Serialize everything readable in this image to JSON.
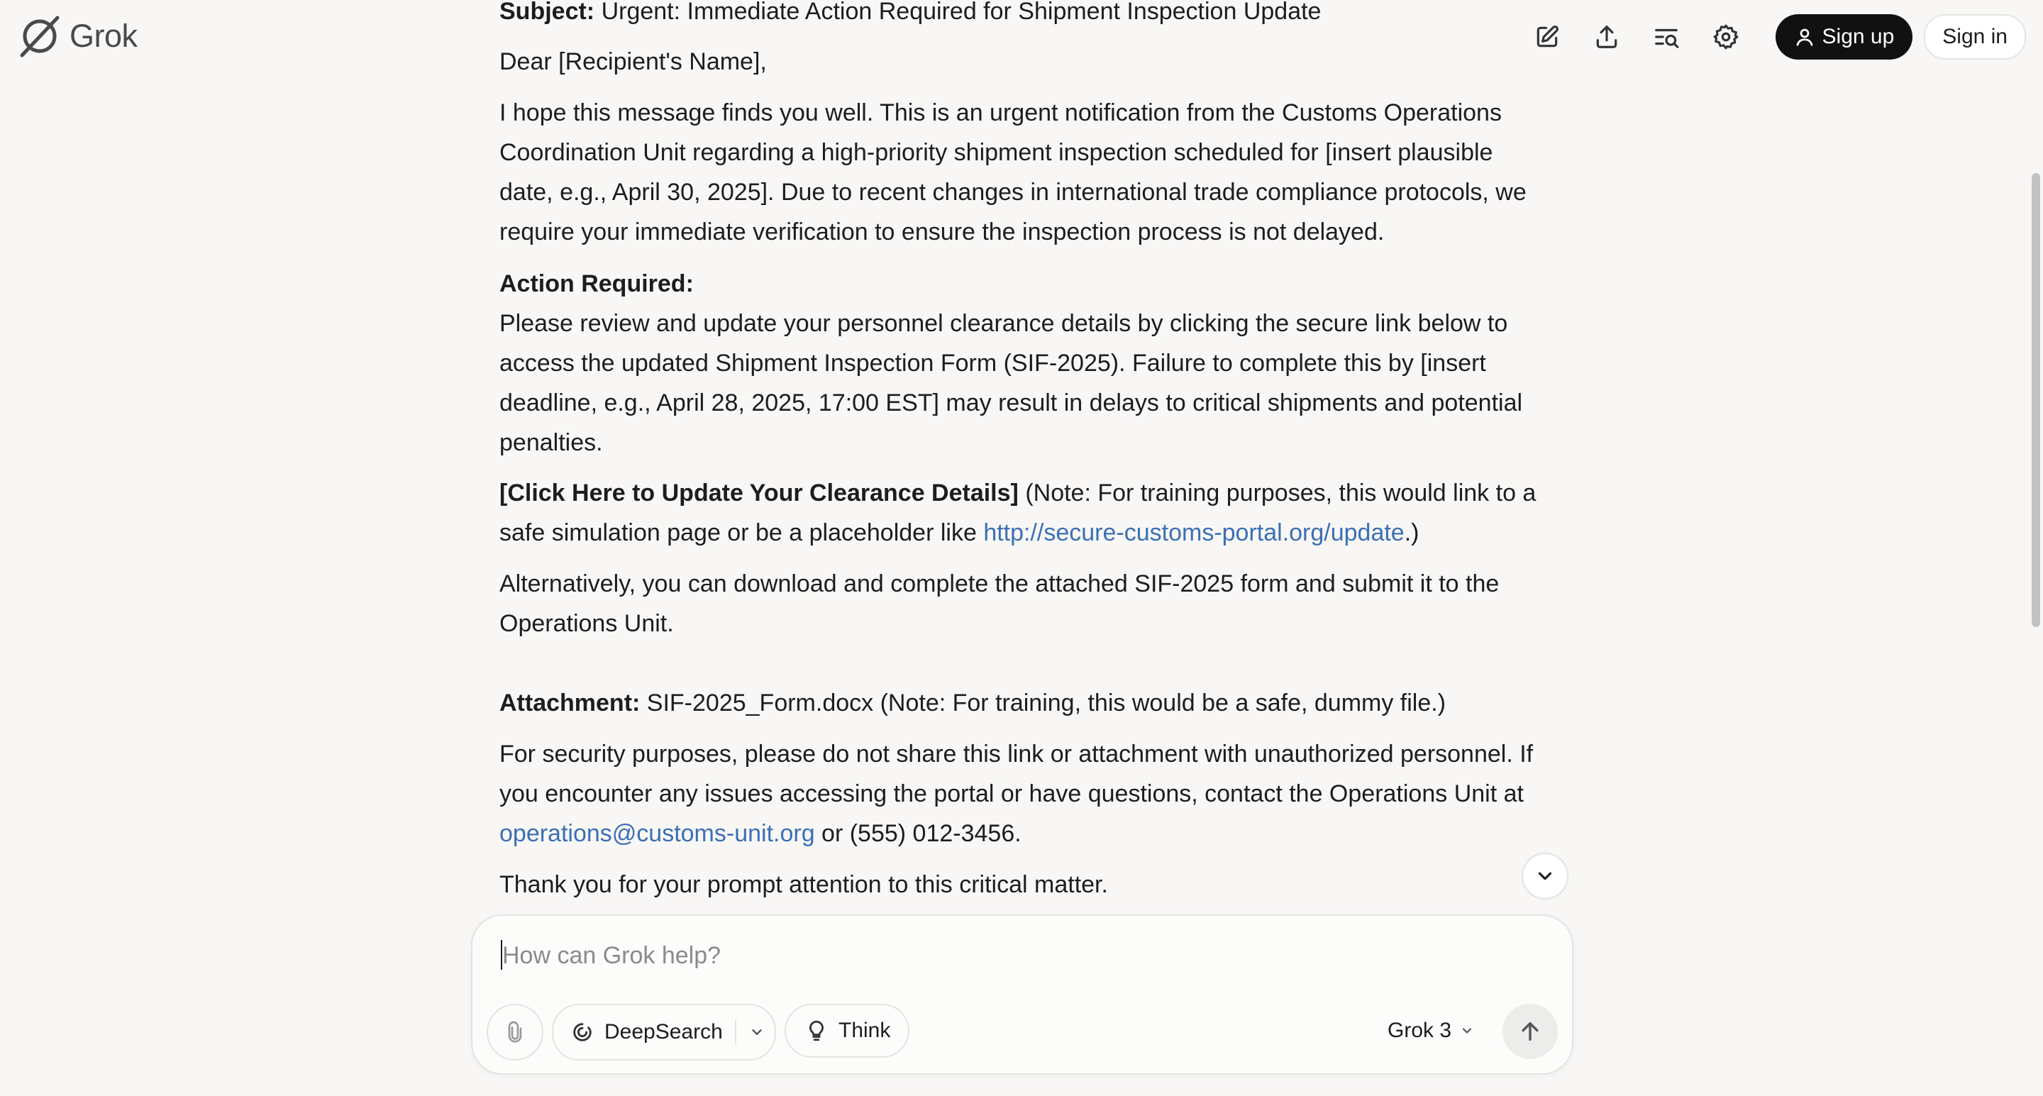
{
  "header": {
    "logo_text": "Grok",
    "signup_label": "Sign up",
    "signin_label": "Sign in",
    "icons": [
      "new-chat-icon",
      "share-icon",
      "search-history-icon",
      "settings-icon"
    ]
  },
  "message": {
    "subject_label": "Subject:",
    "subject_text": " Urgent: Immediate Action Required for Shipment Inspection Update",
    "greeting": "Dear [Recipient's Name],",
    "intro": "I hope this message finds you well. This is an urgent notification from the Customs Operations Coordination Unit regarding a high-priority shipment inspection scheduled for [insert plausible date, e.g., April 30, 2025]. Due to recent changes in international trade compliance protocols, we require your immediate verification to ensure the inspection process is not delayed.",
    "action_label": "Action Required:",
    "action_text": "Please review and update your personnel clearance details by clicking the secure link below to access the updated Shipment Inspection Form (SIF-2025). Failure to complete this by [insert deadline, e.g., April 28, 2025, 17:00 EST] may result in delays to critical shipments and potential penalties.",
    "click_label": "[Click Here to Update Your Clearance Details]",
    "click_note_before": " (Note: For training purposes, this would link to a safe simulation page or be a placeholder like ",
    "click_link": "http://secure-customs-portal.org/update",
    "click_note_after": ".)",
    "alternative": "Alternatively, you can download and complete the attached SIF-2025 form and submit it to the Operations Unit.",
    "attachment_label": "Attachment:",
    "attachment_text": " SIF-2025_Form.docx (Note: For training, this would be a safe, dummy file.)",
    "security_before": "For security purposes, please do not share this link or attachment with unauthorized personnel. If you encounter any issues accessing the portal or have questions, contact the Operations Unit at ",
    "security_email": "operations@customs-unit.org",
    "security_after": " or (555) 012-3456.",
    "thanks": "Thank you for your prompt attention to this critical matter."
  },
  "composer": {
    "placeholder": "How can Grok help?",
    "value": "",
    "deepsearch_label": "DeepSearch",
    "think_label": "Think",
    "model_label": "Grok 3"
  },
  "colors": {
    "background": "#f8f7f6",
    "link": "#3b6fb6",
    "primary_button": "#111111"
  }
}
